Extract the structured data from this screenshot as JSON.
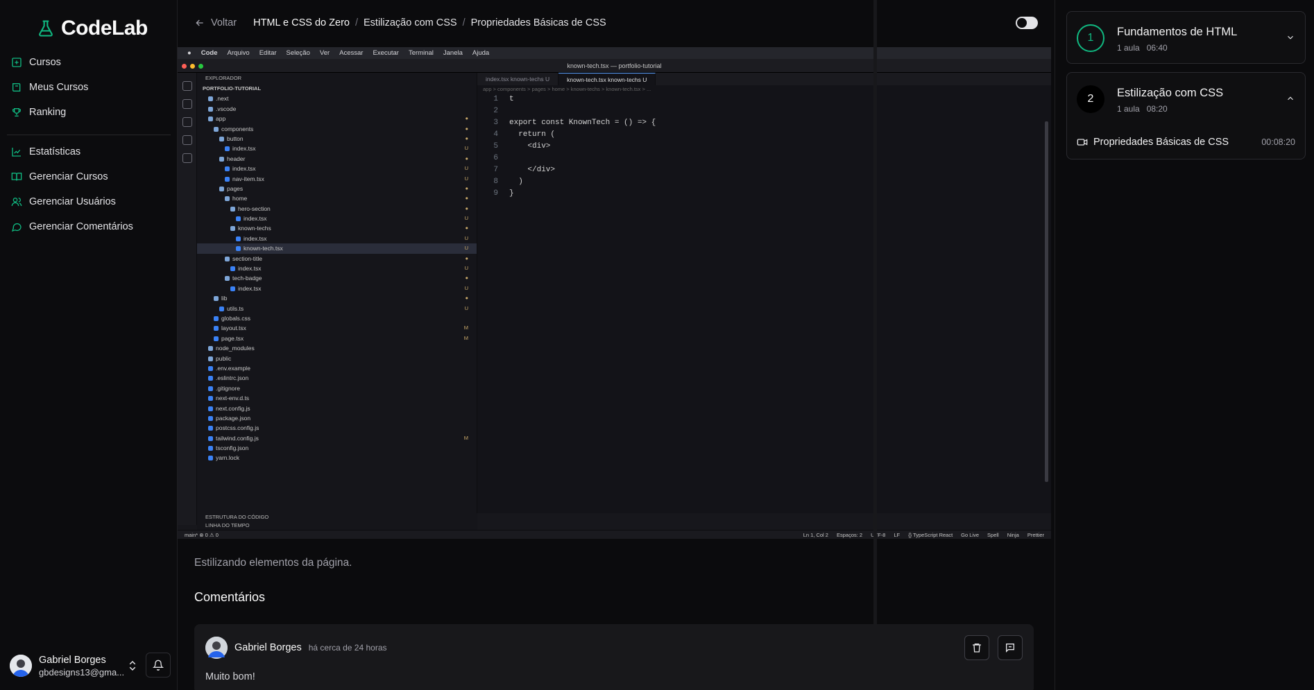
{
  "app": {
    "name": "CodeLab"
  },
  "sidebar": {
    "items": [
      {
        "label": "Cursos",
        "icon": "course-icon"
      },
      {
        "label": "Meus Cursos",
        "icon": "book-icon"
      },
      {
        "label": "Ranking",
        "icon": "trophy-icon"
      },
      {
        "label": "Estatísticas",
        "icon": "chart-icon"
      },
      {
        "label": "Gerenciar Cursos",
        "icon": "open-book-icon"
      },
      {
        "label": "Gerenciar Usuários",
        "icon": "users-icon"
      },
      {
        "label": "Gerenciar Comentários",
        "icon": "message-icon"
      }
    ],
    "user": {
      "name": "Gabriel Borges",
      "email": "gbdesigns13@gma..."
    }
  },
  "topbar": {
    "back_label": "Voltar",
    "breadcrumb": [
      "HTML e CSS do Zero",
      "Estilização com CSS",
      "Propriedades Básicas de CSS"
    ]
  },
  "video": {
    "menubar": [
      "Code",
      "Arquivo",
      "Editar",
      "Seleção",
      "Ver",
      "Acessar",
      "Executar",
      "Terminal",
      "Janela",
      "Ajuda"
    ],
    "window_title": "known-tech.tsx — portfolio-tutorial",
    "explorer_title": "EXPLORADOR",
    "project": "PORTFOLIO-TUTORIAL",
    "tree": [
      {
        "name": ".next",
        "m": ""
      },
      {
        "name": ".vscode",
        "m": ""
      },
      {
        "name": "app",
        "m": "●"
      },
      {
        "name": "components",
        "m": "●"
      },
      {
        "name": "button",
        "m": "●"
      },
      {
        "name": "index.tsx",
        "m": "U"
      },
      {
        "name": "header",
        "m": "●"
      },
      {
        "name": "index.tsx",
        "m": "U"
      },
      {
        "name": "nav-item.tsx",
        "m": "U"
      },
      {
        "name": "pages",
        "m": "●"
      },
      {
        "name": "home",
        "m": "●"
      },
      {
        "name": "hero-section",
        "m": "●"
      },
      {
        "name": "index.tsx",
        "m": "U"
      },
      {
        "name": "known-techs",
        "m": "●"
      },
      {
        "name": "index.tsx",
        "m": "U"
      },
      {
        "name": "known-tech.tsx",
        "m": "U"
      },
      {
        "name": "section-title",
        "m": "●"
      },
      {
        "name": "index.tsx",
        "m": "U"
      },
      {
        "name": "tech-badge",
        "m": "●"
      },
      {
        "name": "index.tsx",
        "m": "U"
      },
      {
        "name": "lib",
        "m": "●"
      },
      {
        "name": "utils.ts",
        "m": "U"
      },
      {
        "name": "globals.css",
        "m": ""
      },
      {
        "name": "layout.tsx",
        "m": "M"
      },
      {
        "name": "page.tsx",
        "m": "M"
      },
      {
        "name": "node_modules",
        "m": ""
      },
      {
        "name": "public",
        "m": ""
      },
      {
        "name": ".env.example",
        "m": ""
      },
      {
        "name": ".eslintrc.json",
        "m": ""
      },
      {
        "name": ".gitignore",
        "m": ""
      },
      {
        "name": "next-env.d.ts",
        "m": ""
      },
      {
        "name": "next.config.js",
        "m": ""
      },
      {
        "name": "package.json",
        "m": ""
      },
      {
        "name": "postcss.config.js",
        "m": ""
      },
      {
        "name": "tailwind.config.js",
        "m": "M"
      },
      {
        "name": "tsconfig.json",
        "m": ""
      },
      {
        "name": "yarn.lock",
        "m": ""
      }
    ],
    "tabs": [
      "index.tsx known-techs U",
      "known-tech.tsx known-techs U"
    ],
    "path": "app > components > pages > home > known-techs > known-tech.tsx > ...",
    "code_lines": [
      "t",
      "",
      "export const KnownTech = () => {",
      "  return (",
      "    <div>",
      "",
      "    </div>",
      "  )",
      "}"
    ],
    "outline": [
      "ESTRUTURA DO CÓDIGO",
      "LINHA DO TEMPO"
    ],
    "status_left": "main*    ⊗ 0 ⚠ 0",
    "status_right": [
      "Ln 1, Col 2",
      "Espaços: 2",
      "UTF-8",
      "LF",
      "{} TypeScript React",
      "Go Live",
      "Spell",
      "Ninja",
      "Prettier"
    ]
  },
  "lesson": {
    "description": "Estilizando elementos da página."
  },
  "comments": {
    "title": "Comentários",
    "items": [
      {
        "author": "Gabriel Borges",
        "time": "há cerca de 24 horas",
        "text": "Muito bom!"
      }
    ]
  },
  "modules": [
    {
      "number": "1",
      "title": "Fundamentos de HTML",
      "meta": "1 aula   06:40"
    },
    {
      "number": "2",
      "title": "Estilização com CSS",
      "meta": "1 aula   08:20",
      "lessons": [
        {
          "title": "Propriedades Básicas de CSS",
          "duration": "00:08:20"
        }
      ]
    }
  ],
  "colors": {
    "accent": "#10b981",
    "bg": "#0b0b0d"
  }
}
